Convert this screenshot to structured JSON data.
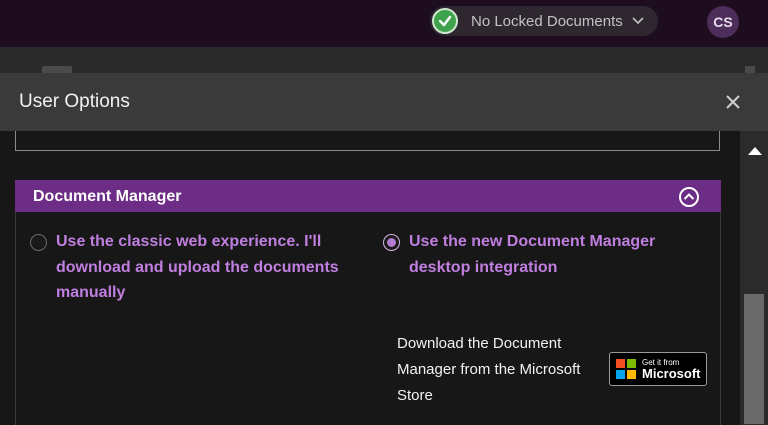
{
  "top_bar": {
    "lock_status": "No Locked Documents",
    "avatar_initials": "CS"
  },
  "modal": {
    "title": "User Options"
  },
  "section": {
    "title": "Document Manager",
    "options": [
      {
        "label": "Use the classic web experience. I'll download and upload the documents manually",
        "selected": false
      },
      {
        "label": "Use the new Document Manager desktop integration",
        "selected": true
      }
    ],
    "download_text": "Download the Document Manager from the Microsoft Store",
    "store_badge": {
      "small": "Get it from",
      "big": "Microsoft"
    }
  },
  "colors": {
    "accent": "#6d2c85",
    "option_text": "#c07fe0",
    "check_green": "#3fa34d"
  },
  "icons": [
    "check-icon",
    "chevron-down-icon",
    "close-icon",
    "collapse-up-icon",
    "microsoft-logo-icon",
    "scroll-up-arrow-icon"
  ]
}
